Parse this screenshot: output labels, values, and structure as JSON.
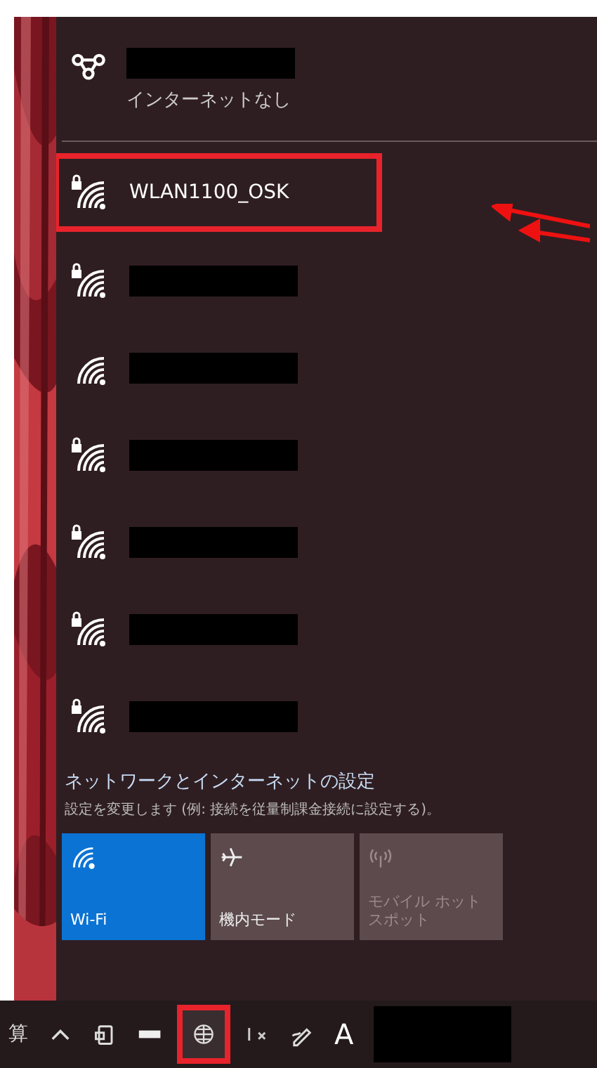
{
  "connected": {
    "status": "インターネットなし",
    "redacted": true
  },
  "networks": [
    {
      "name": "WLAN1100_OSK",
      "locked": true,
      "redacted": false,
      "highlighted": true
    },
    {
      "locked": true,
      "redacted": true,
      "highlighted": false
    },
    {
      "locked": false,
      "redacted": true,
      "highlighted": false
    },
    {
      "locked": true,
      "redacted": true,
      "highlighted": false
    },
    {
      "locked": true,
      "redacted": true,
      "highlighted": false
    },
    {
      "locked": true,
      "redacted": true,
      "highlighted": false
    },
    {
      "locked": true,
      "redacted": true,
      "highlighted": false
    }
  ],
  "settings": {
    "link": "ネットワークとインターネットの設定",
    "description": "設定を変更します (例: 接続を従量制課金接続に設定する)。"
  },
  "tiles": [
    {
      "kind": "wifi",
      "label": "Wi-Fi",
      "on": true,
      "disabled": false
    },
    {
      "kind": "airplane",
      "label": "機内モード",
      "on": false,
      "disabled": false
    },
    {
      "kind": "hotspot",
      "label": "モバイル ホットスポット",
      "on": false,
      "disabled": true
    }
  ],
  "taskbar": {
    "left_char": "算",
    "ime": "A",
    "network_highlighted": true
  }
}
